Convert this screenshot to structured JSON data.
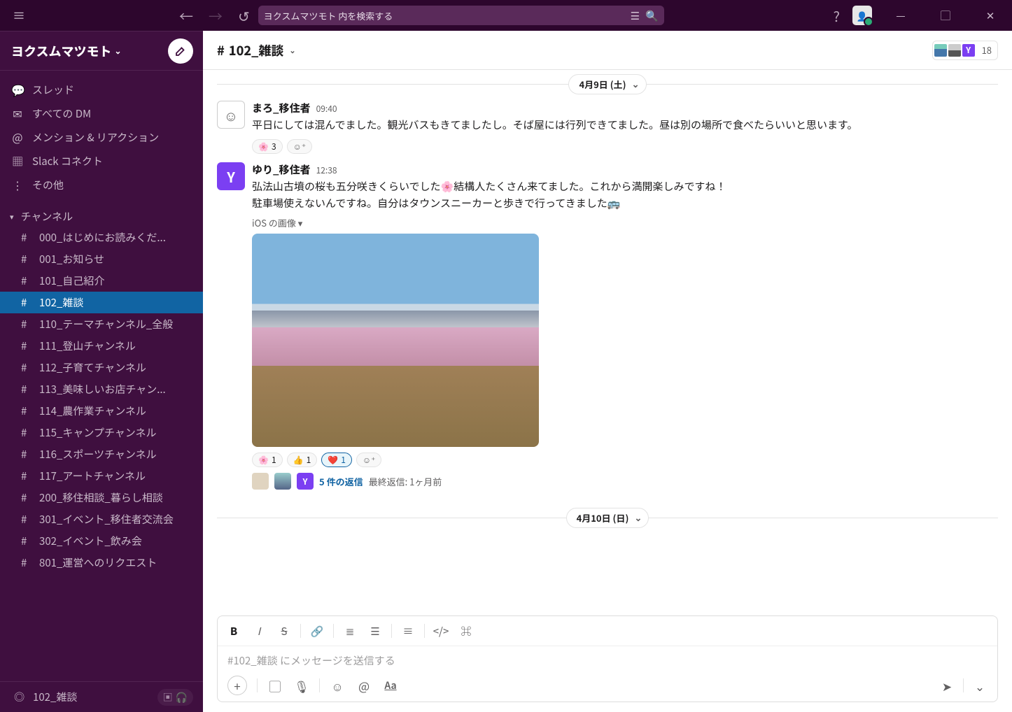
{
  "workspace": {
    "name": "ヨクスムマツモト"
  },
  "search": {
    "placeholder": "ヨクスムマツモト 内を検索する"
  },
  "sidebar_top": {
    "threads": "スレッド",
    "dms": "すべての DM",
    "mentions": "メンション & リアクション",
    "connect": "Slack コネクト",
    "more": "その他"
  },
  "sidebar": {
    "channels_label": "チャンネル",
    "channels": [
      "000_はじめにお読みくだ...",
      "001_お知らせ",
      "101_自己紹介",
      "102_雑談",
      "110_テーマチャンネル_全般",
      "111_登山チャンネル",
      "112_子育てチャンネル",
      "113_美味しいお店チャン...",
      "114_農作業チャンネル",
      "115_キャンプチャンネル",
      "116_スポーツチャンネル",
      "117_アートチャンネル",
      "200_移住相談_暮らし相談",
      "301_イベント_移住者交流会",
      "302_イベント_飲み会",
      "801_運営へのリクエスト"
    ],
    "active_channel": "102_雑談"
  },
  "sidebar_footer": {
    "channel": "102_雑談"
  },
  "channel_header": {
    "name": "102_雑談",
    "member_count": "18",
    "member_letter": "Y"
  },
  "dates": {
    "d1": "4月9日 (土)",
    "d2": "4月10日 (日)"
  },
  "messages": {
    "m1": {
      "user": "まろ_移住者",
      "time": "09:40",
      "text": "平日にしては混んでました。観光バスもきてましたし。そば屋には行列できてました。昼は別の場所で食べたらいいと思います。",
      "react_count": "3"
    },
    "m2": {
      "user": "ゆり_移住者",
      "avatar_letter": "Y",
      "time": "12:38",
      "text1": "弘法山古墳の桜も五分咲きくらいでした🌸結構人たくさん来てました。これから満開楽しみですね！",
      "text2": "駐車場使えないんですね。自分はタウンスニーカーと歩きで行ってきました🚌",
      "attach_label": "iOS の画像 ▾",
      "reacts": {
        "r1": "1",
        "r2": "1",
        "r3": "1"
      },
      "thread": {
        "letter": "Y",
        "link": "5 件の返信",
        "meta": "最終返信: 1ヶ月前"
      }
    }
  },
  "composer": {
    "placeholder": "#102_雑談 にメッセージを送信する"
  }
}
